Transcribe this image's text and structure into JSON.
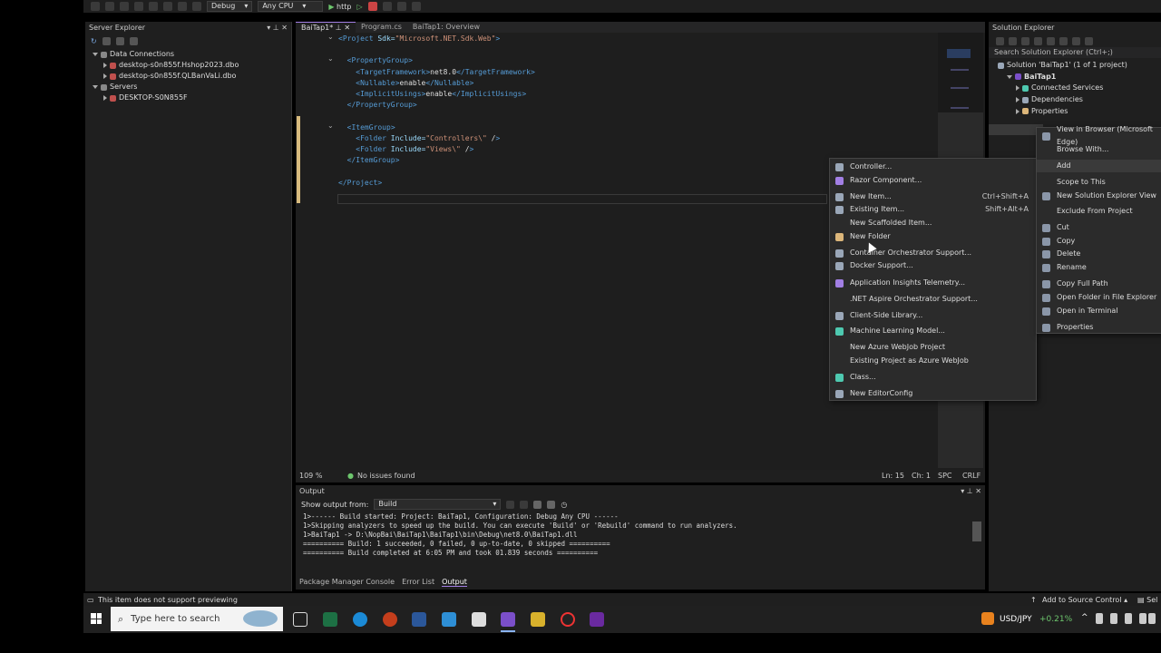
{
  "toolbar": {
    "config": "Debug",
    "platform": "Any CPU",
    "run_target": "http"
  },
  "server_explorer": {
    "title": "Server Explorer",
    "items": [
      {
        "label": "Data Connections",
        "indent": 0,
        "expanded": true
      },
      {
        "label": "desktop-s0n855f.Hshop2023.dbo",
        "indent": 1,
        "expanded": false
      },
      {
        "label": "desktop-s0n855f.QLBanVaLi.dbo",
        "indent": 1,
        "expanded": false
      },
      {
        "label": "Servers",
        "indent": 0,
        "expanded": true
      },
      {
        "label": "DESKTOP-S0N855F",
        "indent": 1,
        "expanded": false
      }
    ]
  },
  "editor": {
    "tabs": [
      {
        "label": "BaiTap1*",
        "active": true
      },
      {
        "label": "Program.cs",
        "active": false
      },
      {
        "label": "BaiTap1: Overview",
        "active": false
      }
    ],
    "code": [
      {
        "t": "<Project Sdk=\"Microsoft.NET.Sdk.Web\">"
      },
      {
        "t": ""
      },
      {
        "t": "  <PropertyGroup>"
      },
      {
        "t": "    <TargetFramework>net8.0</TargetFramework>"
      },
      {
        "t": "    <Nullable>enable</Nullable>"
      },
      {
        "t": "    <ImplicitUsings>enable</ImplicitUsings>"
      },
      {
        "t": "  </PropertyGroup>"
      },
      {
        "t": ""
      },
      {
        "t": "  <ItemGroup>"
      },
      {
        "t": "    <Folder Include=\"Controllers\\\" />"
      },
      {
        "t": "    <Folder Include=\"Views\\\" />"
      },
      {
        "t": "  </ItemGroup>"
      },
      {
        "t": ""
      },
      {
        "t": "</Project>"
      }
    ],
    "status": {
      "zoom": "109 %",
      "issues": "No issues found",
      "line": "Ln: 15",
      "col": "Ch: 1",
      "spc": "SPC",
      "eol": "CRLF"
    }
  },
  "output": {
    "title": "Output",
    "show_from_label": "Show output from:",
    "source": "Build",
    "lines": [
      "1>------ Build started: Project: BaiTap1, Configuration: Debug Any CPU ------",
      "1>Skipping analyzers to speed up the build. You can execute 'Build' or 'Rebuild' command to run analyzers.",
      "1>BaiTap1 -> D:\\NopBai\\BaiTap1\\BaiTap1\\bin\\Debug\\net8.0\\BaiTap1.dll",
      "========== Build: 1 succeeded, 0 failed, 0 up-to-date, 0 skipped ==========",
      "========== Build completed at 6:05 PM and took 01.839 seconds =========="
    ],
    "bottom_tabs": [
      "Package Manager Console",
      "Error List",
      "Output"
    ]
  },
  "solution_explorer": {
    "title": "Solution Explorer",
    "search_placeholder": "Search Solution Explorer (Ctrl+;)",
    "items": [
      {
        "label": "Solution 'BaiTap1' (1 of 1 project)",
        "indent": 0
      },
      {
        "label": "BaiTap1",
        "indent": 1
      },
      {
        "label": "Connected Services",
        "indent": 2
      },
      {
        "label": "Dependencies",
        "indent": 2
      },
      {
        "label": "Properties",
        "indent": 2
      }
    ]
  },
  "add_menu": {
    "items": [
      {
        "label": "Controller...",
        "shortcut": "",
        "icon": "controller-icon",
        "color": "#9aa7b8"
      },
      {
        "label": "Razor Component...",
        "shortcut": "",
        "icon": "razor-icon",
        "color": "#a27fe4"
      },
      {
        "label": "New Item...",
        "shortcut": "Ctrl+Shift+A",
        "icon": "new-item-icon",
        "color": "#9aa7b8"
      },
      {
        "label": "Existing Item...",
        "shortcut": "Shift+Alt+A",
        "icon": "existing-item-icon",
        "color": "#9aa7b8"
      },
      {
        "label": "New Scaffolded Item...",
        "shortcut": "",
        "icon": "",
        "color": ""
      },
      {
        "label": "New Folder",
        "shortcut": "",
        "icon": "folder-icon",
        "color": "#dcb67a"
      },
      {
        "label": "Container Orchestrator Support...",
        "shortcut": "",
        "icon": "container-icon",
        "color": "#9aa7b8"
      },
      {
        "label": "Docker Support...",
        "shortcut": "",
        "icon": "docker-icon",
        "color": "#9aa7b8"
      },
      {
        "label": "Application Insights Telemetry...",
        "shortcut": "",
        "icon": "insights-icon",
        "color": "#a27fe4"
      },
      {
        "label": ".NET Aspire Orchestrator Support...",
        "shortcut": "",
        "icon": "",
        "color": ""
      },
      {
        "label": "Client-Side Library...",
        "shortcut": "",
        "icon": "library-icon",
        "color": "#9aa7b8"
      },
      {
        "label": "Machine Learning Model...",
        "shortcut": "",
        "icon": "ml-icon",
        "color": "#4ec9b0"
      },
      {
        "label": "New Azure WebJob Project",
        "shortcut": "",
        "icon": "",
        "color": ""
      },
      {
        "label": "Existing Project as Azure WebJob",
        "shortcut": "",
        "icon": "",
        "color": ""
      },
      {
        "label": "Class...",
        "shortcut": "",
        "icon": "class-icon",
        "color": "#4ec9b0"
      },
      {
        "label": "New EditorConfig",
        "shortcut": "",
        "icon": "editorconfig-icon",
        "color": "#9aa7b8"
      }
    ]
  },
  "context_menu": {
    "items": [
      {
        "label": "View in Browser (Microsoft Edge)",
        "icon": "browser-icon"
      },
      {
        "label": "Browse With...",
        "icon": ""
      },
      {
        "label": "Add",
        "icon": "",
        "highlight": true
      },
      {
        "label": "Scope to This",
        "icon": ""
      },
      {
        "label": "New Solution Explorer View",
        "icon": "window-icon"
      },
      {
        "label": "Exclude From Project",
        "icon": ""
      },
      {
        "label": "Cut",
        "icon": "cut-icon"
      },
      {
        "label": "Copy",
        "icon": "copy-icon"
      },
      {
        "label": "Delete",
        "icon": "delete-icon"
      },
      {
        "label": "Rename",
        "icon": "rename-icon"
      },
      {
        "label": "Copy Full Path",
        "icon": "copy-path-icon"
      },
      {
        "label": "Open Folder in File Explorer",
        "icon": "open-folder-icon"
      },
      {
        "label": "Open in Terminal",
        "icon": "terminal-icon"
      },
      {
        "label": "Properties",
        "icon": "wrench-icon"
      }
    ]
  },
  "statusbar": {
    "message": "This item does not support previewing",
    "source_control": "Add to Source Control",
    "repo": "Sel"
  },
  "taskbar": {
    "search_placeholder": "Type here to search",
    "ticker": "USD/JPY",
    "ticker_change": "+0.21%"
  }
}
